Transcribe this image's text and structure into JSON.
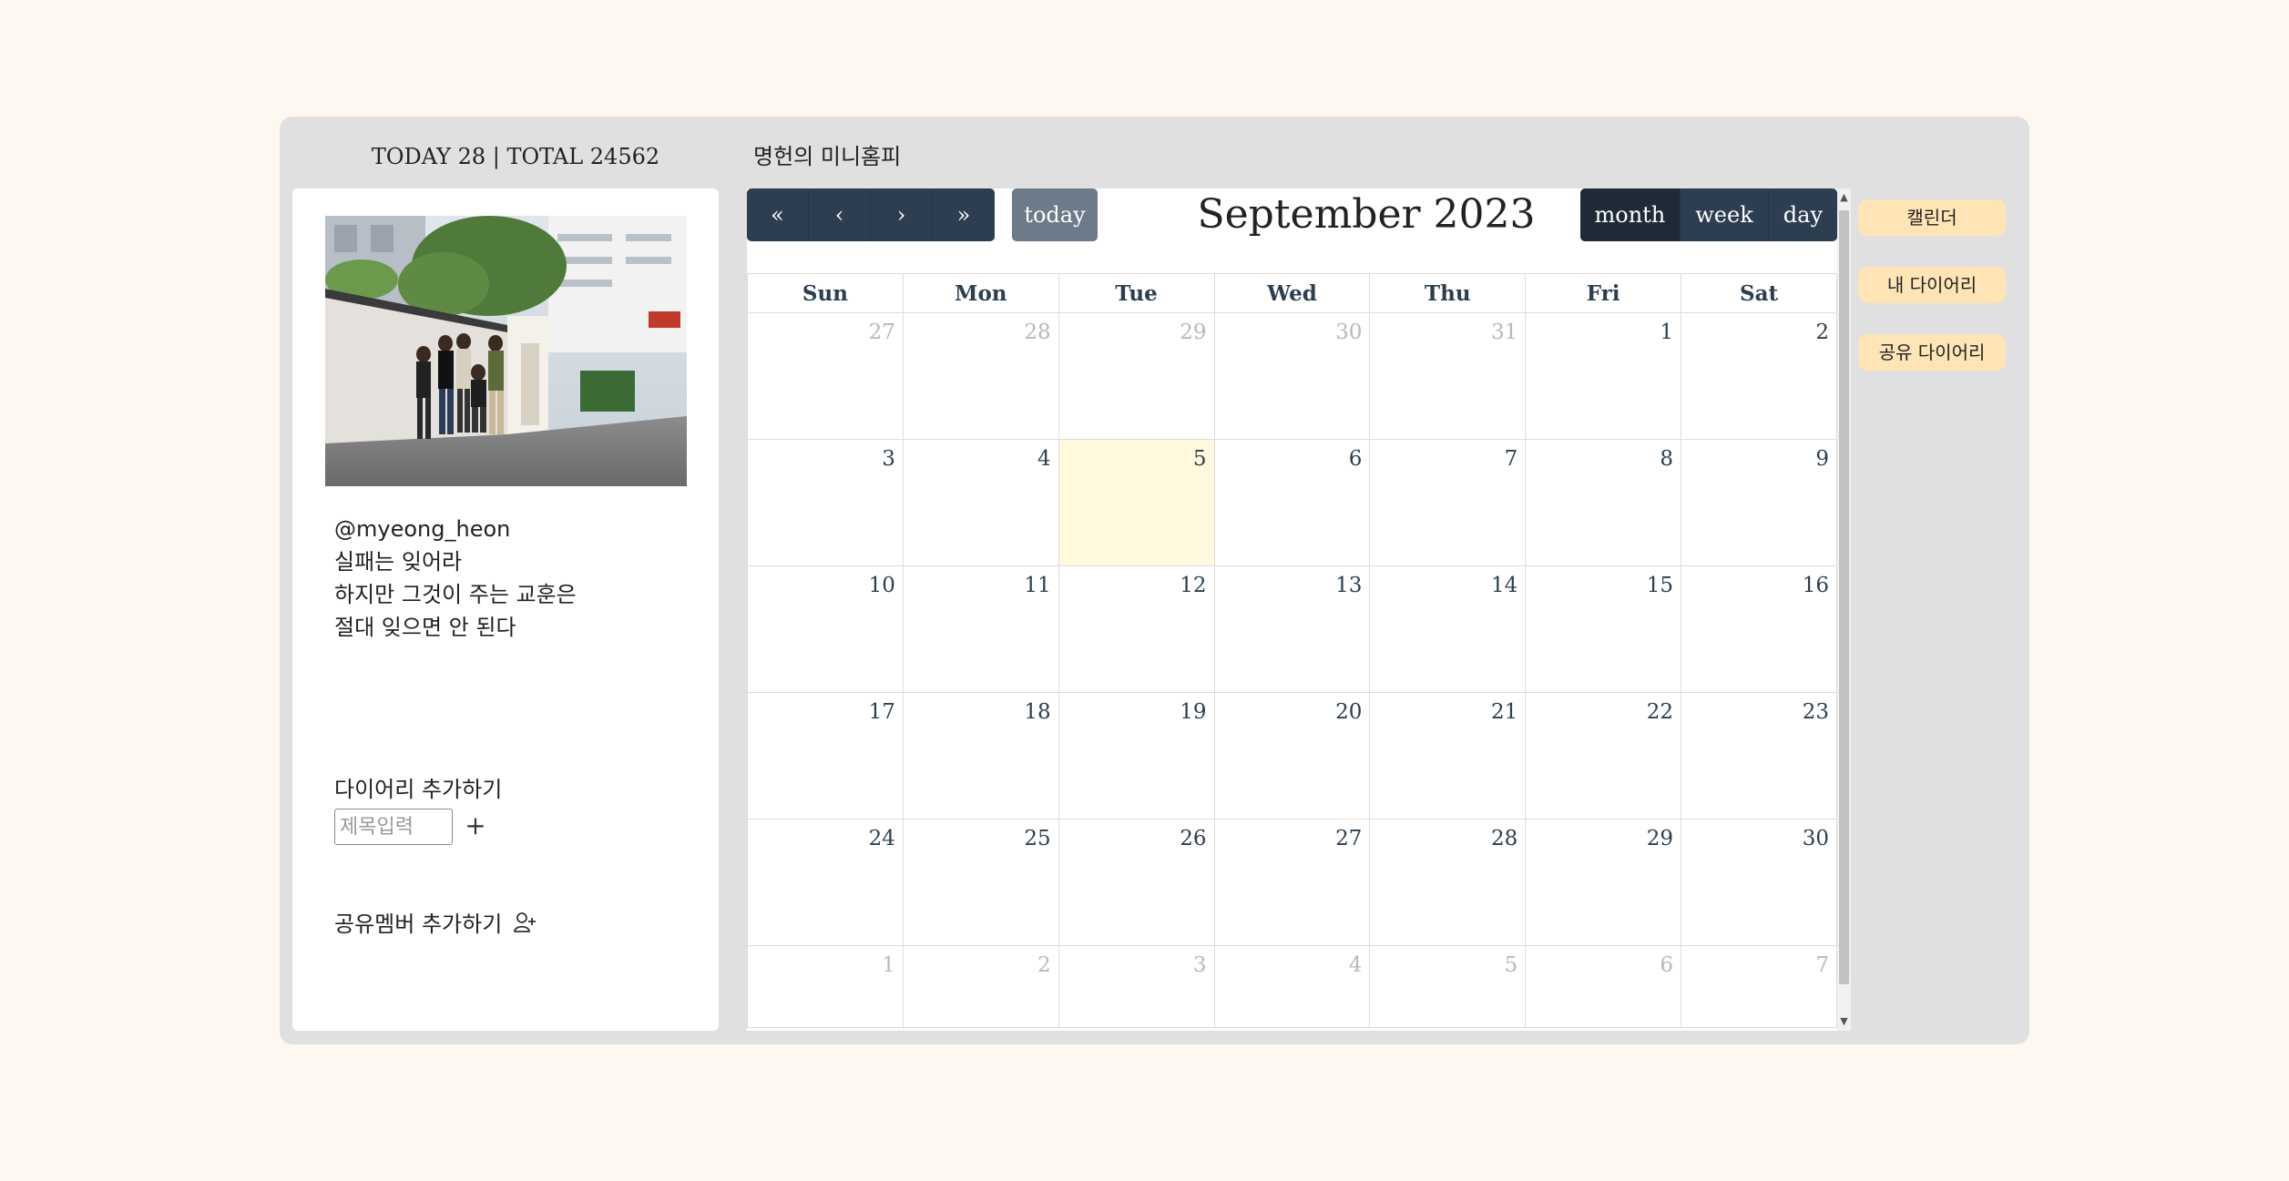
{
  "header": {
    "counter": "TODAY 28 | TOTAL 24562",
    "site_title": "명헌의 미니홈피"
  },
  "profile": {
    "bio_lines": [
      "@myeong_heon",
      "실패는 잊어라",
      "하지만 그것이 주는 교훈은",
      "절대 잊으면 안 된다"
    ],
    "add_diary_label": "다이어리 추가하기",
    "title_input_placeholder": "제목입력",
    "plus_label": "+",
    "share_member_label": "공유멤버 추가하기"
  },
  "calendar": {
    "title": "September 2023",
    "nav_buttons": [
      "«",
      "‹",
      "›",
      "»"
    ],
    "today_label": "today",
    "views": [
      "month",
      "week",
      "day"
    ],
    "active_view": "month",
    "weekdays": [
      "Sun",
      "Mon",
      "Tue",
      "Wed",
      "Thu",
      "Fri",
      "Sat"
    ],
    "weeks": [
      [
        "27",
        "28",
        "29",
        "30",
        "31",
        "1",
        "2"
      ],
      [
        "3",
        "4",
        "5",
        "6",
        "7",
        "8",
        "9"
      ],
      [
        "10",
        "11",
        "12",
        "13",
        "14",
        "15",
        "16"
      ],
      [
        "17",
        "18",
        "19",
        "20",
        "21",
        "22",
        "23"
      ],
      [
        "24",
        "25",
        "26",
        "27",
        "28",
        "29",
        "30"
      ],
      [
        "1",
        "2",
        "3",
        "4",
        "5",
        "6",
        "7"
      ]
    ],
    "today_date": "5",
    "colors": {
      "button": "#2c3e50",
      "today_button": "#6c7a89",
      "today_highlight": "#fff8dc"
    }
  },
  "side_tabs": [
    "캘린더",
    "내 다이어리",
    "공유 다이어리"
  ]
}
